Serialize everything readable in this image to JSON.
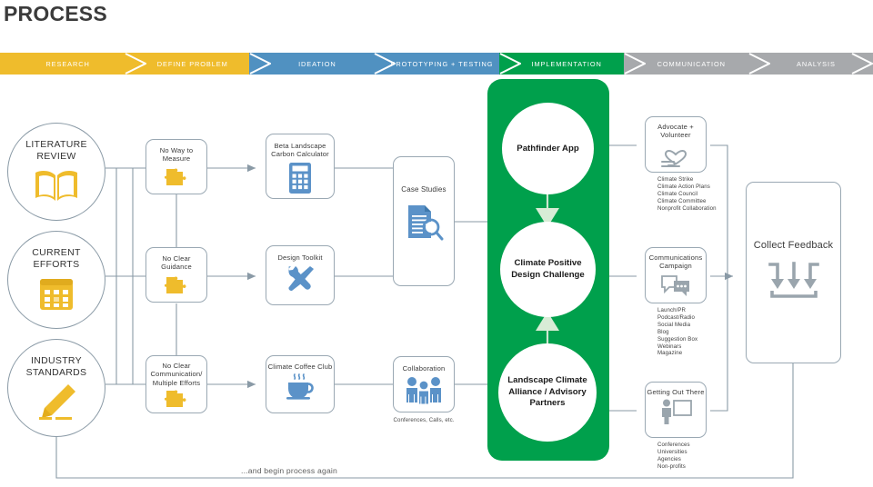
{
  "page": {
    "title": "PROCESS"
  },
  "colors": {
    "yellow": "#efbc2c",
    "blue": "#5091c1",
    "green": "#00a04c",
    "gray": "#a7a9ac",
    "line": "#8a9aa6",
    "icon_blue": "#5b92c8",
    "icon_gray": "#9aa5ad"
  },
  "phase_bar": {
    "phases": [
      {
        "label": "RESEARCH",
        "color": "#efbc2c"
      },
      {
        "label": "DEFINE PROBLEM",
        "color": "#efbc2c"
      },
      {
        "label": "IDEATION",
        "color": "#5091c1"
      },
      {
        "label": "PROTOTYPING + TESTING",
        "color": "#5091c1"
      },
      {
        "label": "IMPLEMENTATION",
        "color": "#00a04c"
      },
      {
        "label": "COMMUNICATION",
        "color": "#a7a9ac"
      },
      {
        "label": "ANALYSIS",
        "color": "#a7a9ac"
      }
    ]
  },
  "inputs": {
    "items": [
      {
        "label": "LITERATURE REVIEW",
        "icon": "open-book-icon"
      },
      {
        "label": "CURRENT EFFORTS",
        "icon": "calendar-icon"
      },
      {
        "label": "INDUSTRY STANDARDS",
        "icon": "pencil-icon"
      }
    ]
  },
  "problems": {
    "items": [
      {
        "label": "No Way to Measure",
        "icon": "puzzle-piece-icon"
      },
      {
        "label": "No Clear Guidance",
        "icon": "puzzle-piece-icon"
      },
      {
        "label": "No Clear Communication/ Multiple Efforts",
        "icon": "puzzle-piece-icon"
      }
    ]
  },
  "tools": {
    "items": [
      {
        "label": "Beta Landscape Carbon Calculator",
        "icon": "calculator-icon"
      },
      {
        "label": "Design Toolkit",
        "icon": "wrench-screwdriver-icon"
      },
      {
        "label": "Climate Coffee Club",
        "icon": "coffee-cup-icon"
      }
    ]
  },
  "evidence": {
    "case_studies": {
      "label": "Case Studies",
      "icon": "document-magnifier-icon"
    },
    "collaboration": {
      "label": "Collaboration",
      "icon": "people-group-icon",
      "caption": "Conferences, Calls, etc."
    }
  },
  "implementation": {
    "nodes": [
      {
        "label": "Pathfinder App"
      },
      {
        "label": "Climate Positive Design Challenge"
      },
      {
        "label": "Landscape Climate Alliance / Advisory Partners"
      }
    ]
  },
  "communication": {
    "groups": [
      {
        "label": "Advocate + Volunteer",
        "icon": "heart-in-hand-icon",
        "items": [
          "Climate Strike",
          "Climate Action Plans",
          "Climate Council",
          "Climate Committee",
          "Nonprofit Collaboration"
        ]
      },
      {
        "label": "Communications Campaign",
        "icon": "speech-bubbles-icon",
        "items": [
          "Launch/PR",
          "Podcast/Radio",
          "Social Media",
          "Blog",
          "Suggestion Box",
          "Webinars",
          "Magazine"
        ]
      },
      {
        "label": "Getting Out There",
        "icon": "presenter-icon",
        "items": [
          "Conferences",
          "Universities",
          "Agencies",
          "Non-profits"
        ]
      }
    ]
  },
  "analysis": {
    "collect_feedback": {
      "label": "Collect Feedback",
      "icon": "download-arrows-icon"
    }
  },
  "loop": {
    "label": "...and begin process again"
  }
}
